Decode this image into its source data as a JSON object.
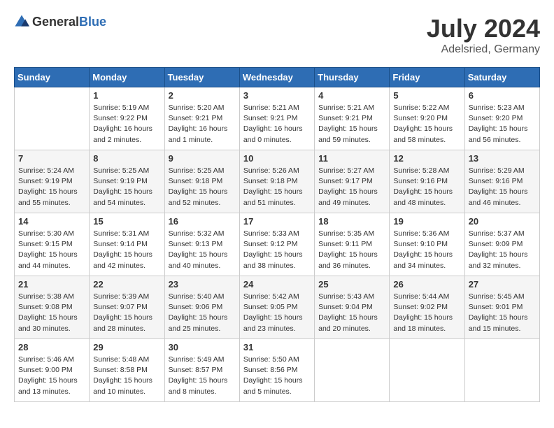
{
  "header": {
    "logo_general": "General",
    "logo_blue": "Blue",
    "month_year": "July 2024",
    "location": "Adelsried, Germany"
  },
  "days_of_week": [
    "Sunday",
    "Monday",
    "Tuesday",
    "Wednesday",
    "Thursday",
    "Friday",
    "Saturday"
  ],
  "weeks": [
    [
      {
        "day": "",
        "sunrise": "",
        "sunset": "",
        "daylight": ""
      },
      {
        "day": "1",
        "sunrise": "Sunrise: 5:19 AM",
        "sunset": "Sunset: 9:22 PM",
        "daylight": "Daylight: 16 hours and 2 minutes."
      },
      {
        "day": "2",
        "sunrise": "Sunrise: 5:20 AM",
        "sunset": "Sunset: 9:21 PM",
        "daylight": "Daylight: 16 hours and 1 minute."
      },
      {
        "day": "3",
        "sunrise": "Sunrise: 5:21 AM",
        "sunset": "Sunset: 9:21 PM",
        "daylight": "Daylight: 16 hours and 0 minutes."
      },
      {
        "day": "4",
        "sunrise": "Sunrise: 5:21 AM",
        "sunset": "Sunset: 9:21 PM",
        "daylight": "Daylight: 15 hours and 59 minutes."
      },
      {
        "day": "5",
        "sunrise": "Sunrise: 5:22 AM",
        "sunset": "Sunset: 9:20 PM",
        "daylight": "Daylight: 15 hours and 58 minutes."
      },
      {
        "day": "6",
        "sunrise": "Sunrise: 5:23 AM",
        "sunset": "Sunset: 9:20 PM",
        "daylight": "Daylight: 15 hours and 56 minutes."
      }
    ],
    [
      {
        "day": "7",
        "sunrise": "Sunrise: 5:24 AM",
        "sunset": "Sunset: 9:19 PM",
        "daylight": "Daylight: 15 hours and 55 minutes."
      },
      {
        "day": "8",
        "sunrise": "Sunrise: 5:25 AM",
        "sunset": "Sunset: 9:19 PM",
        "daylight": "Daylight: 15 hours and 54 minutes."
      },
      {
        "day": "9",
        "sunrise": "Sunrise: 5:25 AM",
        "sunset": "Sunset: 9:18 PM",
        "daylight": "Daylight: 15 hours and 52 minutes."
      },
      {
        "day": "10",
        "sunrise": "Sunrise: 5:26 AM",
        "sunset": "Sunset: 9:18 PM",
        "daylight": "Daylight: 15 hours and 51 minutes."
      },
      {
        "day": "11",
        "sunrise": "Sunrise: 5:27 AM",
        "sunset": "Sunset: 9:17 PM",
        "daylight": "Daylight: 15 hours and 49 minutes."
      },
      {
        "day": "12",
        "sunrise": "Sunrise: 5:28 AM",
        "sunset": "Sunset: 9:16 PM",
        "daylight": "Daylight: 15 hours and 48 minutes."
      },
      {
        "day": "13",
        "sunrise": "Sunrise: 5:29 AM",
        "sunset": "Sunset: 9:16 PM",
        "daylight": "Daylight: 15 hours and 46 minutes."
      }
    ],
    [
      {
        "day": "14",
        "sunrise": "Sunrise: 5:30 AM",
        "sunset": "Sunset: 9:15 PM",
        "daylight": "Daylight: 15 hours and 44 minutes."
      },
      {
        "day": "15",
        "sunrise": "Sunrise: 5:31 AM",
        "sunset": "Sunset: 9:14 PM",
        "daylight": "Daylight: 15 hours and 42 minutes."
      },
      {
        "day": "16",
        "sunrise": "Sunrise: 5:32 AM",
        "sunset": "Sunset: 9:13 PM",
        "daylight": "Daylight: 15 hours and 40 minutes."
      },
      {
        "day": "17",
        "sunrise": "Sunrise: 5:33 AM",
        "sunset": "Sunset: 9:12 PM",
        "daylight": "Daylight: 15 hours and 38 minutes."
      },
      {
        "day": "18",
        "sunrise": "Sunrise: 5:35 AM",
        "sunset": "Sunset: 9:11 PM",
        "daylight": "Daylight: 15 hours and 36 minutes."
      },
      {
        "day": "19",
        "sunrise": "Sunrise: 5:36 AM",
        "sunset": "Sunset: 9:10 PM",
        "daylight": "Daylight: 15 hours and 34 minutes."
      },
      {
        "day": "20",
        "sunrise": "Sunrise: 5:37 AM",
        "sunset": "Sunset: 9:09 PM",
        "daylight": "Daylight: 15 hours and 32 minutes."
      }
    ],
    [
      {
        "day": "21",
        "sunrise": "Sunrise: 5:38 AM",
        "sunset": "Sunset: 9:08 PM",
        "daylight": "Daylight: 15 hours and 30 minutes."
      },
      {
        "day": "22",
        "sunrise": "Sunrise: 5:39 AM",
        "sunset": "Sunset: 9:07 PM",
        "daylight": "Daylight: 15 hours and 28 minutes."
      },
      {
        "day": "23",
        "sunrise": "Sunrise: 5:40 AM",
        "sunset": "Sunset: 9:06 PM",
        "daylight": "Daylight: 15 hours and 25 minutes."
      },
      {
        "day": "24",
        "sunrise": "Sunrise: 5:42 AM",
        "sunset": "Sunset: 9:05 PM",
        "daylight": "Daylight: 15 hours and 23 minutes."
      },
      {
        "day": "25",
        "sunrise": "Sunrise: 5:43 AM",
        "sunset": "Sunset: 9:04 PM",
        "daylight": "Daylight: 15 hours and 20 minutes."
      },
      {
        "day": "26",
        "sunrise": "Sunrise: 5:44 AM",
        "sunset": "Sunset: 9:02 PM",
        "daylight": "Daylight: 15 hours and 18 minutes."
      },
      {
        "day": "27",
        "sunrise": "Sunrise: 5:45 AM",
        "sunset": "Sunset: 9:01 PM",
        "daylight": "Daylight: 15 hours and 15 minutes."
      }
    ],
    [
      {
        "day": "28",
        "sunrise": "Sunrise: 5:46 AM",
        "sunset": "Sunset: 9:00 PM",
        "daylight": "Daylight: 15 hours and 13 minutes."
      },
      {
        "day": "29",
        "sunrise": "Sunrise: 5:48 AM",
        "sunset": "Sunset: 8:58 PM",
        "daylight": "Daylight: 15 hours and 10 minutes."
      },
      {
        "day": "30",
        "sunrise": "Sunrise: 5:49 AM",
        "sunset": "Sunset: 8:57 PM",
        "daylight": "Daylight: 15 hours and 8 minutes."
      },
      {
        "day": "31",
        "sunrise": "Sunrise: 5:50 AM",
        "sunset": "Sunset: 8:56 PM",
        "daylight": "Daylight: 15 hours and 5 minutes."
      },
      {
        "day": "",
        "sunrise": "",
        "sunset": "",
        "daylight": ""
      },
      {
        "day": "",
        "sunrise": "",
        "sunset": "",
        "daylight": ""
      },
      {
        "day": "",
        "sunrise": "",
        "sunset": "",
        "daylight": ""
      }
    ]
  ]
}
